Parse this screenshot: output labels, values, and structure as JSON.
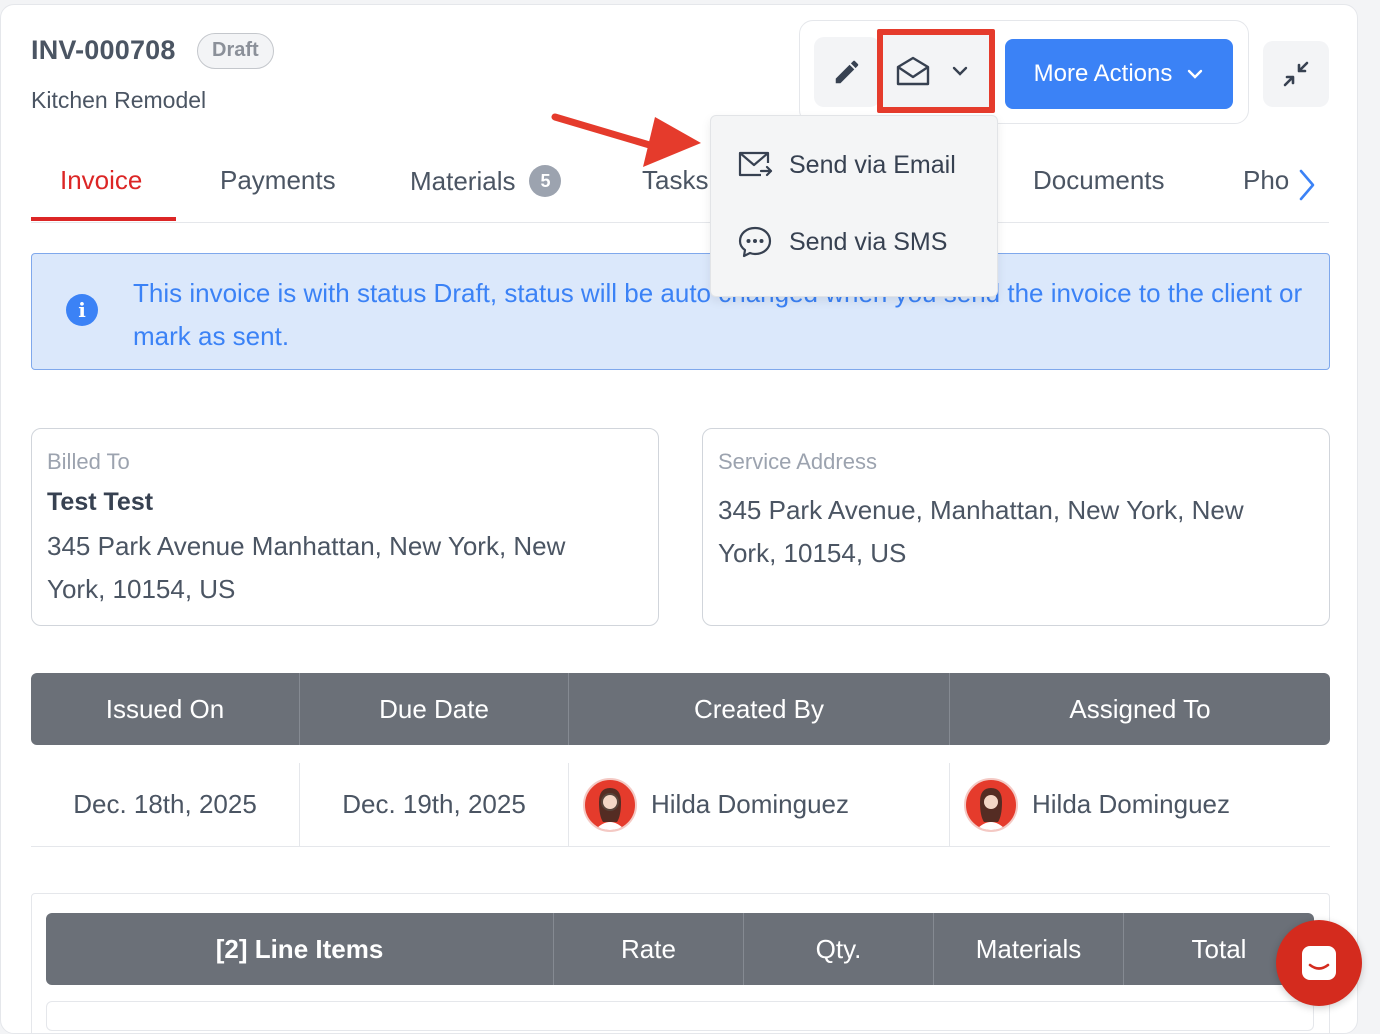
{
  "invoice": {
    "id": "INV-000708",
    "status": "Draft",
    "subtitle": "Kitchen Remodel"
  },
  "toolbar": {
    "edit_icon": "pencil-icon",
    "send_icon": "envelope-open-icon",
    "more_actions_label": "More Actions",
    "collapse_icon": "collapse-arrows-icon"
  },
  "send_menu": {
    "items": [
      {
        "label": "Send via Email",
        "icon": "email-send-icon"
      },
      {
        "label": "Send via SMS",
        "icon": "chat-bubble-icon"
      }
    ]
  },
  "tabs": [
    {
      "label": "Invoice",
      "active": true
    },
    {
      "label": "Payments"
    },
    {
      "label": "Materials",
      "count": "5"
    },
    {
      "label": "Tasks"
    },
    {
      "label": "Documents"
    },
    {
      "label": "Pho"
    }
  ],
  "notice": {
    "text": "This invoice is with status Draft, status will be auto changed when you send the invoice to the client or mark as sent."
  },
  "billed_to": {
    "label": "Billed To",
    "name": "Test Test",
    "address_line1": "345 Park Avenue Manhattan, New York, New",
    "address_line2": "York, 10154, US"
  },
  "service_address": {
    "label": "Service Address",
    "address_line1": "345 Park Avenue, Manhattan, New York, New",
    "address_line2": "York, 10154, US"
  },
  "info_table": {
    "headers": [
      "Issued On",
      "Due Date",
      "Created By",
      "Assigned To"
    ],
    "issued_on": "Dec. 18th, 2025",
    "due_date": "Dec. 19th, 2025",
    "created_by": "Hilda Dominguez",
    "assigned_to": "Hilda Dominguez"
  },
  "line_items": {
    "headers": [
      "[2] Line Items",
      "Rate",
      "Qty.",
      "Materials",
      "Total"
    ]
  },
  "colors": {
    "accent_red": "#dc2626",
    "primary_blue": "#3b82f6",
    "highlight_red": "#e53b2c",
    "table_header": "#6b7078"
  }
}
